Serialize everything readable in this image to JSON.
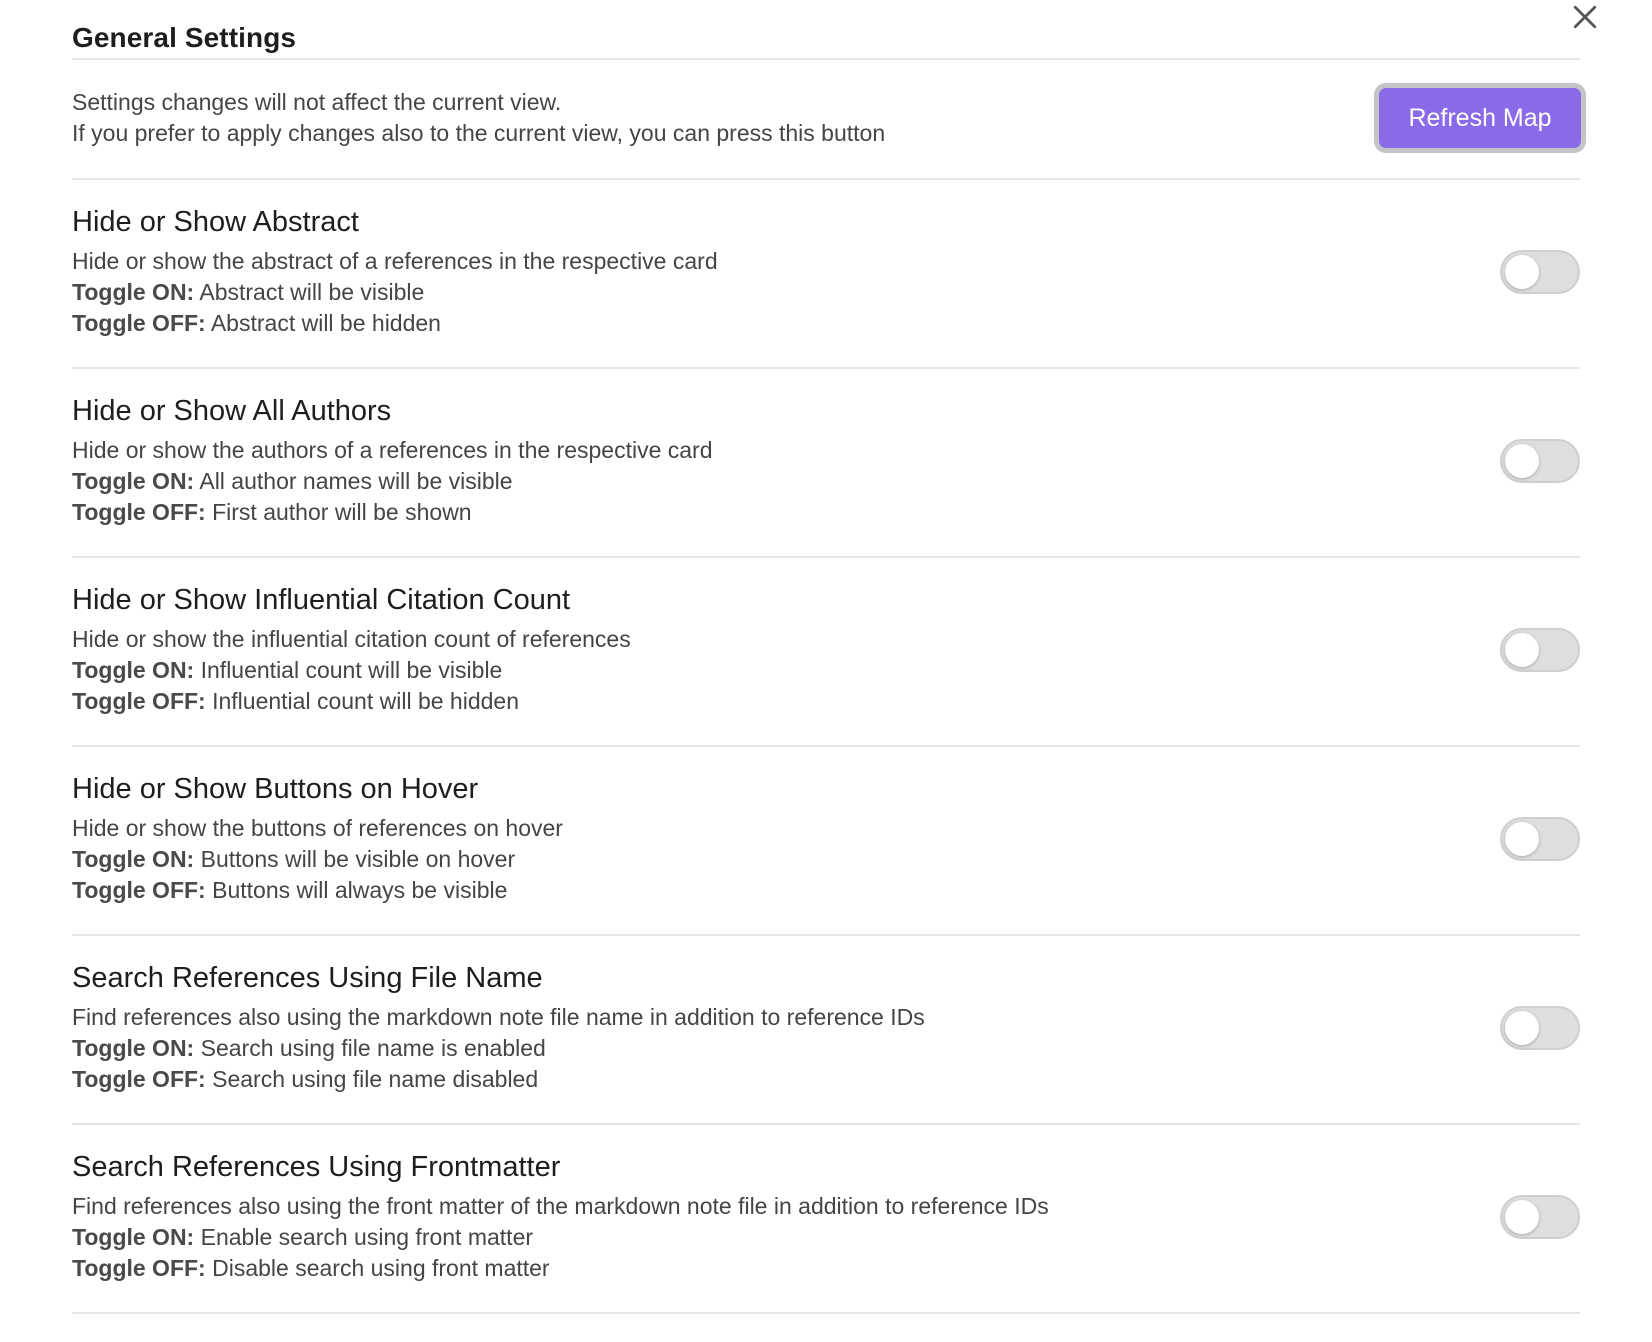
{
  "modal": {
    "title": "General Settings",
    "close_icon": "close-icon"
  },
  "info": {
    "line1": "Settings changes will not affect the current view.",
    "line2": "If you prefer to apply changes also to the current view, you can press this button",
    "refresh_label": "Refresh Map",
    "accent_color": "#8a6ae8"
  },
  "settings": [
    {
      "name": "Hide or Show Abstract",
      "description": "Hide or show the abstract of a references in the respective card",
      "on_label": "Toggle ON:",
      "on_text": " Abstract will be visible",
      "off_label": "Toggle OFF:",
      "off_text": " Abstract will be hidden",
      "enabled": false
    },
    {
      "name": "Hide or Show All Authors",
      "description": "Hide or show the authors of a references in the respective card",
      "on_label": "Toggle ON:",
      "on_text": " All author names will be visible",
      "off_label": "Toggle OFF:",
      "off_text": " First author will be shown",
      "enabled": false
    },
    {
      "name": "Hide or Show Influential Citation Count",
      "description": "Hide or show the influential citation count of references",
      "on_label": "Toggle ON:",
      "on_text": " Influential count will be visible",
      "off_label": "Toggle OFF:",
      "off_text": " Influential count will be hidden",
      "enabled": false
    },
    {
      "name": "Hide or Show Buttons on Hover",
      "description": "Hide or show the buttons of references on hover",
      "on_label": "Toggle ON:",
      "on_text": " Buttons will be visible on hover",
      "off_label": "Toggle OFF:",
      "off_text": " Buttons will always be visible",
      "enabled": false
    },
    {
      "name": "Search References Using File Name",
      "description": "Find references also using the markdown note file name in addition to reference IDs",
      "on_label": "Toggle ON:",
      "on_text": " Search using file name is enabled",
      "off_label": "Toggle OFF:",
      "off_text": " Search using file name disabled",
      "enabled": false
    },
    {
      "name": "Search References Using Frontmatter",
      "description": "Find references also using the front matter of the markdown note file in addition to reference IDs",
      "on_label": "Toggle ON:",
      "on_text": " Enable search using front matter",
      "off_label": "Toggle OFF:",
      "off_text": " Disable search using front matter",
      "enabled": false
    }
  ]
}
